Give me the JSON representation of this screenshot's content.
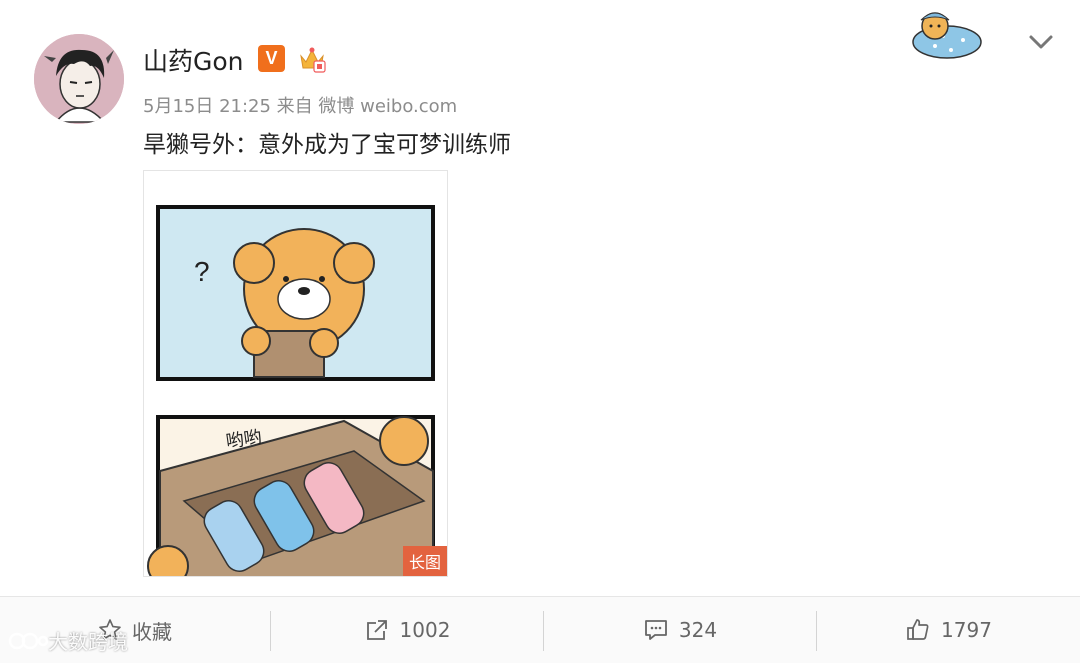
{
  "post": {
    "username": "山药Gon",
    "verified_badge": "V",
    "crown_icon": "crown-badge-icon",
    "meta": "5月15日 21:25 来自 微博 weibo.com",
    "text": "旱獭号外：意外成为了宝可梦训练师",
    "image_tag": "长图",
    "panel_text": "哟哟"
  },
  "actions": {
    "favorite_label": "收藏",
    "repost_count": "1002",
    "comment_count": "324",
    "like_count": "1797"
  },
  "watermark": "大数跨境",
  "colors": {
    "accent_orange": "#f06f1c",
    "tag_red": "#e3633f",
    "muted_text": "#8c8c8c"
  }
}
